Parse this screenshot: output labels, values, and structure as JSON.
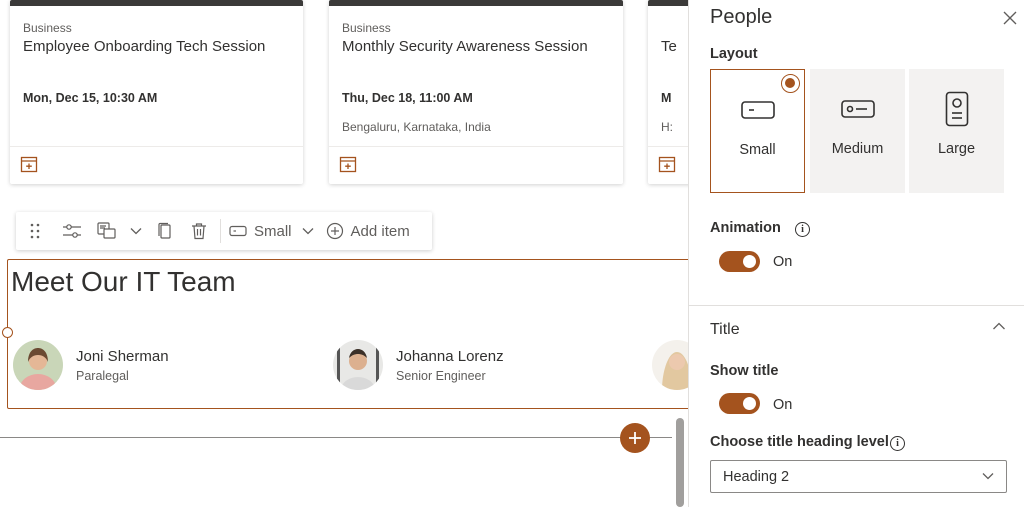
{
  "events": [
    {
      "category": "Business",
      "title": "Employee Onboarding Tech Session",
      "date": "Mon, Dec 15, 10:30 AM",
      "location": ""
    },
    {
      "category": "Business",
      "title": "Monthly Security Awareness Session",
      "date": "Thu, Dec 18, 11:00 AM",
      "location": "Bengaluru, Karnataka, India"
    },
    {
      "category": "",
      "title": "Te",
      "date": "M",
      "location": "H:"
    }
  ],
  "toolbar": {
    "layout_value": "Small",
    "add_item_label": "Add item"
  },
  "people_section": {
    "title": "Meet Our IT Team",
    "people": [
      {
        "name": "Joni Sherman",
        "role": "Paralegal"
      },
      {
        "name": "Johanna Lorenz",
        "role": "Senior Engineer"
      }
    ]
  },
  "panel": {
    "title": "People",
    "layout_label": "Layout",
    "layout_options": [
      {
        "label": "Small",
        "selected": true,
        "icon": "small-card-icon"
      },
      {
        "label": "Medium",
        "selected": false,
        "icon": "medium-card-icon"
      },
      {
        "label": "Large",
        "selected": false,
        "icon": "large-card-icon"
      }
    ],
    "animation_label": "Animation",
    "animation_state": "On",
    "title_section_label": "Title",
    "show_title_label": "Show title",
    "show_title_state": "On",
    "heading_level_label": "Choose title heading level",
    "heading_level_value": "Heading 2"
  },
  "colors": {
    "accent": "#a4531e",
    "text": "#323130",
    "muted": "#605e5c"
  }
}
